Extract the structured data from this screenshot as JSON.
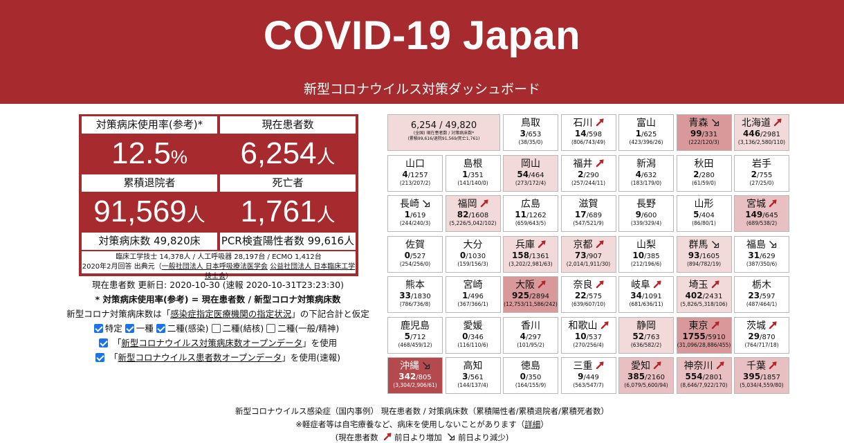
{
  "header": {
    "title": "COVID-19 Japan",
    "subtitle": "新型コロナウイルス対策ダッシュボード"
  },
  "stats": {
    "bed_usage_label": "対策病床使用率(参考)*",
    "bed_usage_value": "12.5",
    "bed_usage_unit": "%",
    "current_patients_label": "現在患者数",
    "current_patients_value": "6,254",
    "current_patients_unit": "人",
    "discharged_label": "累積退院者",
    "discharged_value": "91,569",
    "discharged_unit": "人",
    "deaths_label": "死亡者",
    "deaths_value": "1,761",
    "deaths_unit": "人",
    "beds_label": "対策病床数 49,820床",
    "pcr_label": "PCR検査陽性者数 99,616人",
    "equipment_line": "臨床工学技士 14,378人 / 人工呼吸器 28,197台 / ECMO 1,412台",
    "source_prefix": "2020年2月回答 出典元（",
    "source_link1": "一般社団法人 日本呼吸療法医学会",
    "source_link2": "公益社団法人 日本臨床工学技士会",
    "source_suffix": "）"
  },
  "info": {
    "updated": "現在患者数 更新日: 2020-10-30 (速報 2020-10-31T23:23:30)",
    "formula": "* 対策病床使用率(参考) = 現在患者数 / 新型コロナ対策病床数",
    "assume_prefix": "新型コロナ対策病床数は「",
    "assume_link": "感染症指定医療機関の指定状況",
    "assume_suffix": "」の下記合計と仮定",
    "checkboxes": [
      {
        "label": "特定",
        "checked": true
      },
      {
        "label": "一種",
        "checked": true
      },
      {
        "label": "二種(感染)",
        "checked": true
      },
      {
        "label": "二種(結核)",
        "checked": false
      },
      {
        "label": "二種(一般/精神)",
        "checked": false
      }
    ],
    "open_data_1_prefix": "「",
    "open_data_1_link": "新型コロナウイルス対策病床数オープンデータ",
    "open_data_1_suffix": "」を使用",
    "open_data_2_prefix": "「",
    "open_data_2_link": "新型コロナウイルス患者数オープンデータ",
    "open_data_2_suffix": "」を使用(速報)"
  },
  "total_cell": {
    "main": "6,254 / 49,820",
    "note1": "(全国) 現在患者数 / 対策病床数*",
    "note2": "(累積99,616/退院91,569/死亡1,761)"
  },
  "prefectures": [
    {
      "name": "鳥取",
      "cur": "3",
      "beds": "653",
      "sub": "(38/35/0)",
      "trend": "",
      "level": 0
    },
    {
      "name": "石川",
      "cur": "14",
      "beds": "598",
      "sub": "(806/743/49)",
      "trend": "up",
      "level": 0
    },
    {
      "name": "富山",
      "cur": "1",
      "beds": "625",
      "sub": "(423/396/26)",
      "trend": "",
      "level": 0
    },
    {
      "name": "青森",
      "cur": "99",
      "beds": "331",
      "sub": "(222/120/3)",
      "trend": "down",
      "level": 3
    },
    {
      "name": "北海道",
      "cur": "446",
      "beds": "2981",
      "sub": "(3,136/2,580/110)",
      "trend": "up",
      "level": 1
    },
    {
      "name": "山口",
      "cur": "4",
      "beds": "1257",
      "sub": "(213/207/2)",
      "trend": "",
      "level": 0
    },
    {
      "name": "島根",
      "cur": "1",
      "beds": "351",
      "sub": "(141/140/0)",
      "trend": "",
      "level": 0
    },
    {
      "name": "岡山",
      "cur": "54",
      "beds": "464",
      "sub": "(273/172/4)",
      "trend": "",
      "level": 1
    },
    {
      "name": "福井",
      "cur": "2",
      "beds": "290",
      "sub": "(257/244/11)",
      "trend": "up",
      "level": 0
    },
    {
      "name": "新潟",
      "cur": "4",
      "beds": "632",
      "sub": "(183/179/0)",
      "trend": "",
      "level": 0
    },
    {
      "name": "秋田",
      "cur": "2",
      "beds": "280",
      "sub": "(61/59/0)",
      "trend": "",
      "level": 0
    },
    {
      "name": "岩手",
      "cur": "2",
      "beds": "755",
      "sub": "(27/25/0)",
      "trend": "",
      "level": 0
    },
    {
      "name": "長崎",
      "cur": "1",
      "beds": "619",
      "sub": "(244/240/3)",
      "trend": "down",
      "level": 0
    },
    {
      "name": "福岡",
      "cur": "82",
      "beds": "1608",
      "sub": "(5,226/5,042/102)",
      "trend": "up",
      "level": 1
    },
    {
      "name": "広島",
      "cur": "11",
      "beds": "1262",
      "sub": "(659/643/5)",
      "trend": "",
      "level": 0
    },
    {
      "name": "滋賀",
      "cur": "17",
      "beds": "689",
      "sub": "(547/521/9)",
      "trend": "",
      "level": 0
    },
    {
      "name": "長野",
      "cur": "9",
      "beds": "600",
      "sub": "(339/329/4)",
      "trend": "",
      "level": 0
    },
    {
      "name": "山形",
      "cur": "5",
      "beds": "404",
      "sub": "(86/80/1)",
      "trend": "",
      "level": 0
    },
    {
      "name": "宮城",
      "cur": "149",
      "beds": "645",
      "sub": "(689/538/2)",
      "trend": "up",
      "level": 2
    },
    {
      "name": "佐賀",
      "cur": "0",
      "beds": "527",
      "sub": "(254/256/0)",
      "trend": "",
      "level": 0
    },
    {
      "name": "大分",
      "cur": "0",
      "beds": "1030",
      "sub": "(159/156/3)",
      "trend": "",
      "level": 0
    },
    {
      "name": "兵庫",
      "cur": "158",
      "beds": "1361",
      "sub": "(3,202/2,981/63)",
      "trend": "up",
      "level": 1
    },
    {
      "name": "京都",
      "cur": "73",
      "beds": "907",
      "sub": "(2,014/1,911/30)",
      "trend": "up",
      "level": 1
    },
    {
      "name": "山梨",
      "cur": "10",
      "beds": "385",
      "sub": "(212/196/6)",
      "trend": "",
      "level": 0
    },
    {
      "name": "群馬",
      "cur": "93",
      "beds": "1605",
      "sub": "(894/782/19)",
      "trend": "down",
      "level": 1
    },
    {
      "name": "福島",
      "cur": "31",
      "beds": "629",
      "sub": "(387/350/6)",
      "trend": "down",
      "level": 0
    },
    {
      "name": "熊本",
      "cur": "33",
      "beds": "1830",
      "sub": "(786/736/8)",
      "trend": "",
      "level": 0
    },
    {
      "name": "宮崎",
      "cur": "1",
      "beds": "496",
      "sub": "(367/366/1)",
      "trend": "",
      "level": 0
    },
    {
      "name": "大阪",
      "cur": "925",
      "beds": "2894",
      "sub": "(12,753/11,586/242)",
      "trend": "up",
      "level": 3
    },
    {
      "name": "奈良",
      "cur": "22",
      "beds": "575",
      "sub": "(639/607/10)",
      "trend": "up",
      "level": 0
    },
    {
      "name": "岐阜",
      "cur": "34",
      "beds": "1091",
      "sub": "(681/636/11)",
      "trend": "up",
      "level": 0
    },
    {
      "name": "埼玉",
      "cur": "402",
      "beds": "2431",
      "sub": "(5,826/5,318/106)",
      "trend": "up",
      "level": 1
    },
    {
      "name": "栃木",
      "cur": "23",
      "beds": "597",
      "sub": "(487/464/1)",
      "trend": "",
      "level": 0
    },
    {
      "name": "鹿児島",
      "cur": "5",
      "beds": "712",
      "sub": "(468/459/12)",
      "trend": "",
      "level": 0
    },
    {
      "name": "愛媛",
      "cur": "0",
      "beds": "346",
      "sub": "(116/110/6)",
      "trend": "",
      "level": 0
    },
    {
      "name": "香川",
      "cur": "4",
      "beds": "297",
      "sub": "(101/95/2)",
      "trend": "",
      "level": 0
    },
    {
      "name": "和歌山",
      "cur": "10",
      "beds": "537",
      "sub": "(270/256/4)",
      "trend": "up",
      "level": 0
    },
    {
      "name": "静岡",
      "cur": "52",
      "beds": "763",
      "sub": "(636/582/2)",
      "trend": "",
      "level": 1
    },
    {
      "name": "東京",
      "cur": "1755",
      "beds": "5910",
      "sub": "(31,096/28,886/455)",
      "trend": "up",
      "level": 3
    },
    {
      "name": "茨城",
      "cur": "29",
      "beds": "870",
      "sub": "(764/717/18)",
      "trend": "up",
      "level": 0
    },
    {
      "name": "沖縄",
      "cur": "342",
      "beds": "805",
      "sub": "(3,304/2,906/61)",
      "trend": "down",
      "level": 4
    },
    {
      "name": "高知",
      "cur": "3",
      "beds": "561",
      "sub": "(144/137/4)",
      "trend": "",
      "level": 0
    },
    {
      "name": "徳島",
      "cur": "0",
      "beds": "350",
      "sub": "(164/155/9)",
      "trend": "",
      "level": 0
    },
    {
      "name": "三重",
      "cur": "9",
      "beds": "449",
      "sub": "(563/547/7)",
      "trend": "up",
      "level": 0
    },
    {
      "name": "愛知",
      "cur": "385",
      "beds": "2160",
      "sub": "(6,079/5,600/94)",
      "trend": "up",
      "level": 2
    },
    {
      "name": "神奈川",
      "cur": "554",
      "beds": "2801",
      "sub": "(8,646/7,922/170)",
      "trend": "up",
      "level": 2
    },
    {
      "name": "千葉",
      "cur": "395",
      "beds": "1857",
      "sub": "(5,034/4,559/80)",
      "trend": "up",
      "level": 2
    }
  ],
  "bottom": {
    "line1": "新型コロナウイルス感染症（国内事例） 現在患者数 / 対策病床数（累積陽性者/累積退院者/累積死者数）",
    "line2_prefix": "※軽症者等は自宅療養など、病床を使用しないことがあります（",
    "line2_link": "詳細",
    "line2_suffix": "）",
    "legend_prefix": "(現在患者数",
    "legend_up": "前日より増加",
    "legend_down": "前日より減少)"
  },
  "colors": {
    "brand": "#a72a2e",
    "level1": "#f2dada",
    "level2": "#e9c0c2",
    "level3": "#d9999b",
    "level4": "#b54a4e"
  }
}
